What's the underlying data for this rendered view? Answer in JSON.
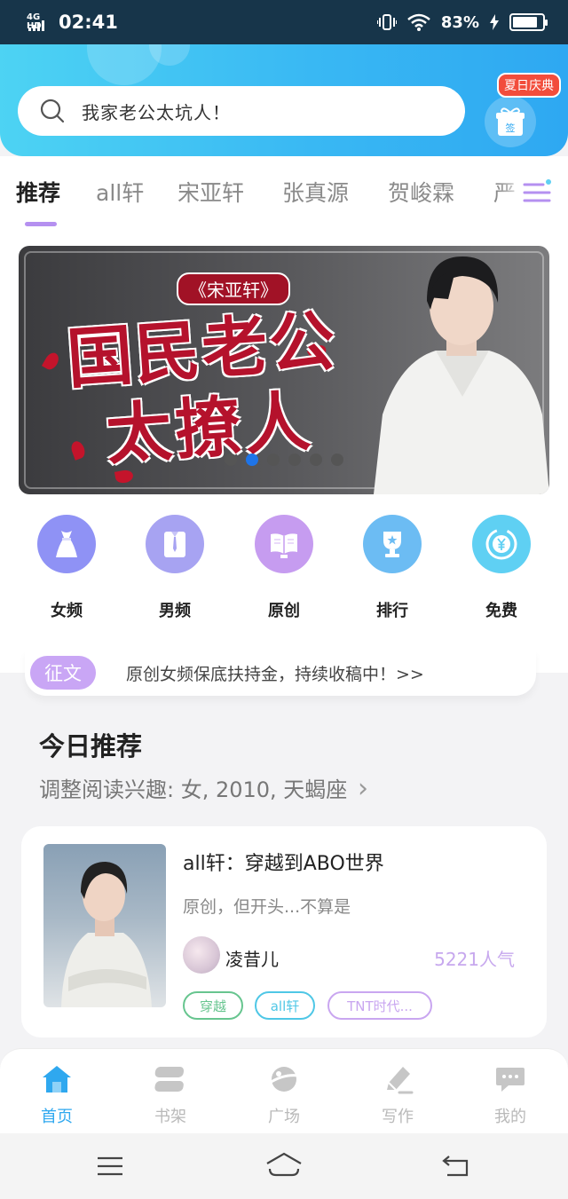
{
  "status_bar": {
    "network": "4G HD",
    "time": "02:41",
    "battery": "83%",
    "battery_fraction": 0.83
  },
  "header": {
    "search_placeholder": "我家老公太坑人！",
    "gift_badge": "夏日庆典",
    "gift_sign": "签"
  },
  "tabs": [
    {
      "label": "推荐",
      "active": true
    },
    {
      "label": "all轩",
      "active": false
    },
    {
      "label": "宋亚轩",
      "active": false
    },
    {
      "label": "张真源",
      "active": false
    },
    {
      "label": "贺峻霖",
      "active": false
    },
    {
      "label": "严",
      "active": false
    }
  ],
  "banner": {
    "subtitle": "《宋亚轩》",
    "title_line1": "国民老公",
    "title_line2": "太撩人",
    "active_dot": 1,
    "dot_count": 6
  },
  "categories": [
    {
      "label": "女频",
      "icon": "dress-icon",
      "color": "#8f92f5"
    },
    {
      "label": "男频",
      "icon": "shirt-icon",
      "color": "#a7a3f2"
    },
    {
      "label": "原创",
      "icon": "book-icon",
      "color": "#c69cf0"
    },
    {
      "label": "排行",
      "icon": "trophy-icon",
      "color": "#6cbcf3"
    },
    {
      "label": "免费",
      "icon": "yuan-coin-icon",
      "color": "#5fd0f3"
    }
  ],
  "notice": {
    "badge": "征文",
    "text": "原创女频保底扶持金，持续收稿中！>>"
  },
  "today": {
    "title": "今日推荐",
    "subtitle": "调整阅读兴趣: 女, 2010, 天蝎座",
    "chevron": "›"
  },
  "book": {
    "title": "all轩：穿越到ABO世界",
    "description": "原创，但开头...不算是",
    "author": "凌昔儿",
    "popularity": "5221人气",
    "tags": [
      {
        "label": "穿越",
        "color": "#67c58f"
      },
      {
        "label": "all轩",
        "color": "#4fc7e6"
      },
      {
        "label": "TNT时代...",
        "color": "#c9a6f0"
      }
    ]
  },
  "bottom_nav": [
    {
      "label": "首页",
      "icon": "home-icon",
      "active": true
    },
    {
      "label": "书架",
      "icon": "bookshelf-icon",
      "active": false
    },
    {
      "label": "广场",
      "icon": "planet-icon",
      "active": false
    },
    {
      "label": "写作",
      "icon": "pen-icon",
      "active": false
    },
    {
      "label": "我的",
      "icon": "chat-bubble-icon",
      "active": false
    }
  ],
  "colors": {
    "accent": "#2fa8ef",
    "tab_indicator": "#b590f0",
    "header_start": "#4dd3f3",
    "header_end": "#2ea8f2"
  }
}
